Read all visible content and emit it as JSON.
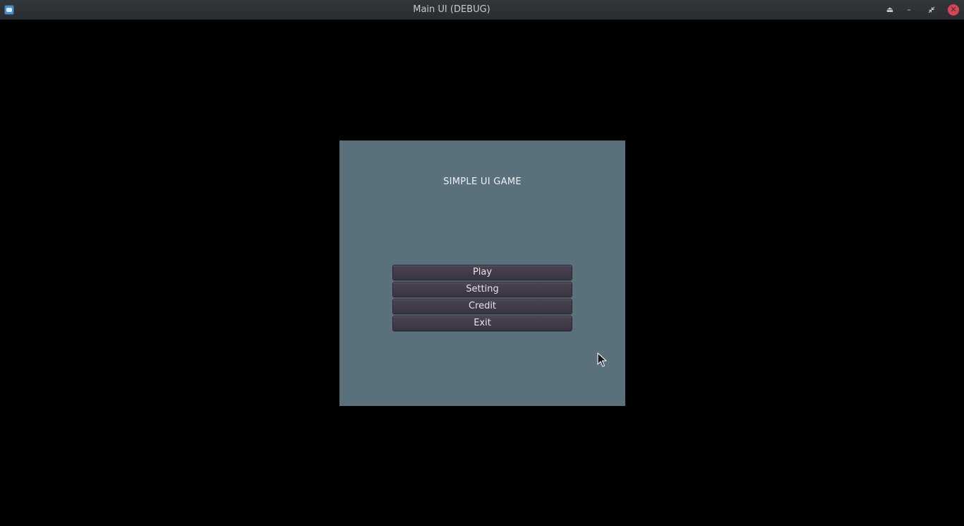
{
  "window": {
    "title": "Main UI (DEBUG)",
    "app_icon": "godot-app-icon",
    "controls": {
      "keep_above_icon": "eject-icon",
      "minimize_icon": "minimize-icon",
      "restore_icon": "restore-icon",
      "close_icon": "close-icon"
    }
  },
  "game": {
    "background_color": "#5a717b",
    "title": "SIMPLE UI GAME",
    "menu": {
      "play": "Play",
      "setting": "Setting",
      "credit": "Credit",
      "exit": "Exit"
    }
  },
  "colors": {
    "outer_background": "#000000",
    "button_fill": "#3f3947",
    "close_button": "#da4453"
  }
}
